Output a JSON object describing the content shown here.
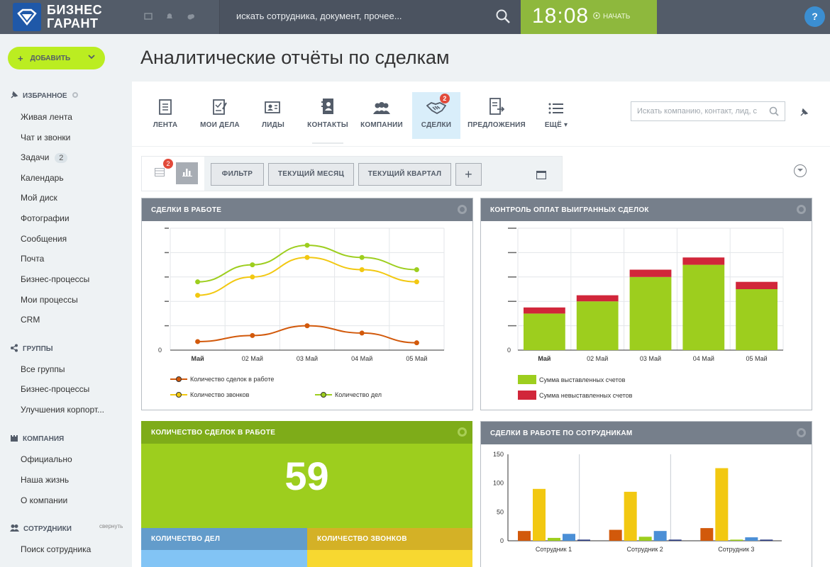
{
  "logo": {
    "line1": "БИЗНЕС",
    "line2": "ГАРАНТ"
  },
  "header": {
    "search_placeholder": "искать сотрудника, документ, прочее...",
    "time": "18:08",
    "start_label": "НАЧАТЬ",
    "help": "?"
  },
  "sidebar": {
    "add_label": "ДОБАВИТЬ",
    "favorites_title": "ИЗБРАННОЕ",
    "favorites": [
      "Живая лента",
      "Чат и звонки",
      "Задачи",
      "Календарь",
      "Мой диск",
      "Фотографии",
      "Сообщения",
      "Почта",
      "Бизнес-процессы",
      "Мои процессы",
      "CRM"
    ],
    "tasks_badge": "2",
    "groups_title": "ГРУППЫ",
    "groups": [
      "Все группы",
      "Бизнес-процессы",
      "Улучшения корпорт..."
    ],
    "company_title": "КОМПАНИЯ",
    "company": [
      "Официально",
      "Наша жизнь",
      "О компании"
    ],
    "staff_title": "СОТРУДНИКИ",
    "collapse_label": "свернуть",
    "staff": [
      "Поиск сотрудника"
    ]
  },
  "page_title": "Аналитические отчёты по сделкам",
  "tabs": [
    {
      "label": "ЛЕНТА",
      "icon": "document-icon"
    },
    {
      "label": "МОИ ДЕЛА",
      "icon": "checklist-icon"
    },
    {
      "label": "ЛИДЫ",
      "icon": "contact-card-icon"
    },
    {
      "label": "КОНТАКТЫ",
      "icon": "address-book-icon"
    },
    {
      "label": "КОМПАНИИ",
      "icon": "people-icon"
    },
    {
      "label": "СДЕЛКИ",
      "icon": "handshake-icon",
      "count": "2"
    },
    {
      "label": "ПРЕДЛОЖЕНИЯ",
      "icon": "export-document-icon"
    },
    {
      "label": "ЕЩЁ",
      "icon": "list-icon"
    }
  ],
  "crm_search_placeholder": "Искать компанию, контакт, лид, с",
  "filter_bar": {
    "view_count": "2",
    "filter_label": "ФИЛЬТР",
    "month_label": "ТЕКУЩИЙ МЕСЯЦ",
    "quarter_label": "ТЕКУЩИЙ КВАРТАЛ",
    "add_label": "+"
  },
  "widgets": {
    "deals_in_work": "СДЕЛКИ В РАБОТЕ",
    "payment_control": "КОНТРОЛЬ ОПЛАТ ВЫИГРАННЫХ СДЕЛОК",
    "deals_count": "КОЛИЧЕСТВО СДЕЛОК В РАБОТЕ",
    "deals_count_value": "59",
    "tasks_count": "КОЛИЧЕСТВО ДЕЛ",
    "calls_count": "КОЛИЧЕСТВО ЗВОНКОВ",
    "by_employee": "СДЕЛКИ В РАБОТЕ ПО СОТРУДНИКАМ"
  },
  "colors": {
    "green": "#9dce1e",
    "yellow": "#f2c811",
    "orange": "#d2590b",
    "red": "#d1263a",
    "blue": "#4b8fd6",
    "navy": "#2b3b80"
  },
  "chart_data": [
    {
      "type": "line",
      "categories": [
        "Май",
        "02 Май",
        "03 Май",
        "04 Май",
        "05 Май"
      ],
      "yticks": [
        "0"
      ],
      "series": [
        {
          "name": "Количество сделок в работе",
          "color": "#d2590b",
          "values": [
            0.7,
            1.2,
            2.0,
            1.4,
            0.6
          ]
        },
        {
          "name": "Количество звонков",
          "color": "#f2c811",
          "values": [
            4.5,
            6.0,
            7.6,
            6.6,
            5.6
          ]
        },
        {
          "name": "Количество дел",
          "color": "#9dce1e",
          "values": [
            5.6,
            7.0,
            8.6,
            7.6,
            6.6
          ]
        }
      ],
      "ylim": [
        0,
        10
      ]
    },
    {
      "type": "bar",
      "stacked": true,
      "categories": [
        "Май",
        "02 Май",
        "03 Май",
        "04 Май",
        "05 Май"
      ],
      "yticks": [
        "0"
      ],
      "series": [
        {
          "name": "Сумма выставленных счетов",
          "color": "#9dce1e",
          "values": [
            30,
            40,
            60,
            70,
            50
          ]
        },
        {
          "name": "Сумма невыставленных счетов",
          "color": "#d1263a",
          "values": [
            5,
            5,
            6,
            6,
            6
          ]
        }
      ],
      "ylim": [
        0,
        100
      ]
    },
    {
      "type": "bar",
      "categories": [
        "Сотрудник 1",
        "Сотрудник 2",
        "Сотрудник 3"
      ],
      "yticks": [
        "0",
        "50",
        "100",
        "150"
      ],
      "ylim": [
        0,
        150
      ],
      "series": [
        {
          "color": "#d2590b",
          "values": [
            17,
            19,
            22
          ]
        },
        {
          "color": "#f2c811",
          "values": [
            90,
            85,
            126
          ]
        },
        {
          "color": "#9dce1e",
          "values": [
            5,
            7,
            2
          ]
        },
        {
          "color": "#4b8fd6",
          "values": [
            12,
            17,
            6
          ]
        },
        {
          "color": "#2b3b80",
          "values": [
            2,
            2,
            2
          ]
        }
      ]
    }
  ]
}
